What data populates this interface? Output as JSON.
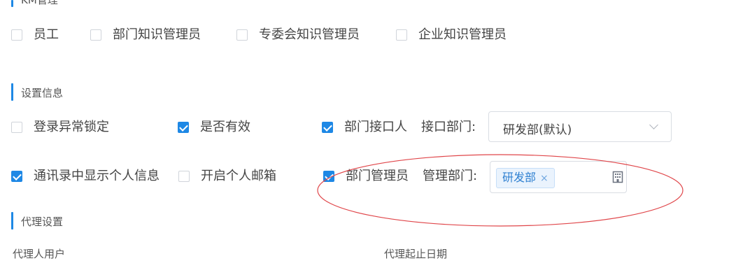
{
  "km_section": {
    "title": "KM管理",
    "options": [
      {
        "label": "员工",
        "checked": false
      },
      {
        "label": "部门知识管理员",
        "checked": false
      },
      {
        "label": "专委会知识管理员",
        "checked": false
      },
      {
        "label": "企业知识管理员",
        "checked": false
      }
    ]
  },
  "settings_section": {
    "title": "设置信息",
    "login_lock": {
      "label": "登录异常锁定",
      "checked": false
    },
    "is_valid": {
      "label": "是否有效",
      "checked": true
    },
    "interface_person": {
      "label": "部门接口人",
      "checked": true
    },
    "interface_dept": {
      "label": "接口部门:",
      "value": "研发部(默认)"
    },
    "show_in_contacts": {
      "label": "通讯录中显示个人信息",
      "checked": true
    },
    "personal_email": {
      "label": "开启个人邮箱",
      "checked": false
    },
    "dept_admin": {
      "label": "部门管理员",
      "checked": true
    },
    "managed_dept": {
      "label": "管理部门:",
      "tags": [
        "研发部"
      ],
      "tag_remove": "×"
    }
  },
  "proxy_section": {
    "title": "代理设置",
    "field_left": "代理人用户",
    "field_right": "代理起止日期"
  },
  "colors": {
    "accent": "#1e88e5",
    "annotation": "#e0464a"
  },
  "icons": {
    "building": "building-icon",
    "chevron": "chevron-down-icon"
  }
}
